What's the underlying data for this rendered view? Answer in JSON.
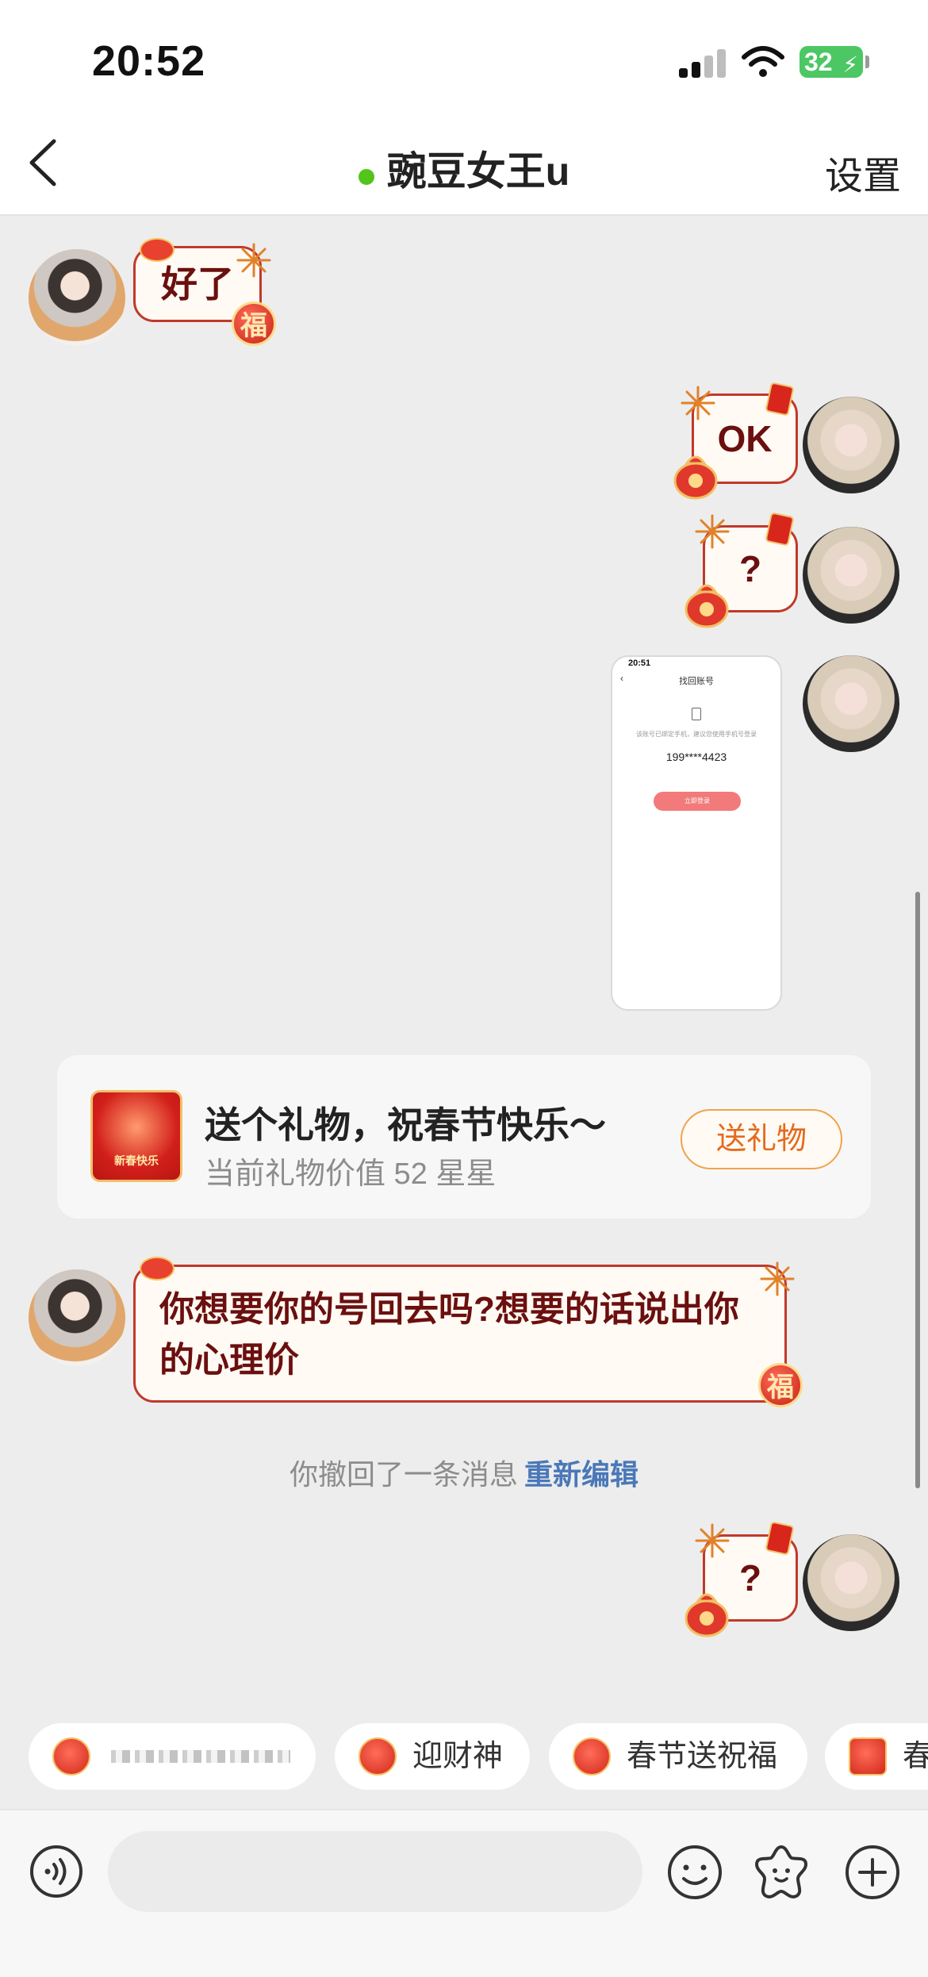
{
  "status_bar": {
    "time": "20:52",
    "battery": "32"
  },
  "header": {
    "title": "豌豆女王u",
    "settings_label": "设置"
  },
  "messages": [
    {
      "sender": "other",
      "type": "text",
      "text": "好了"
    },
    {
      "sender": "me",
      "type": "text",
      "text": "OK"
    },
    {
      "sender": "me",
      "type": "text",
      "text": "?"
    },
    {
      "sender": "me",
      "type": "image",
      "screenshot": {
        "time": "20:51",
        "title": "找回账号",
        "description": "该账号已绑定手机，建议您使用手机号登录",
        "phone_number": "199****4423",
        "button": "立即登录"
      }
    },
    {
      "sender": "other",
      "type": "text",
      "text": "你想要你的号回去吗?想要的话说出你的心理价"
    },
    {
      "sender": "me",
      "type": "text",
      "text": "?"
    }
  ],
  "gift_card": {
    "icon_text": "新春快乐",
    "title": "送个礼物，祝春节快乐～",
    "subtitle": "当前礼物价值 52 星星",
    "button": "送礼物"
  },
  "recall_notice": {
    "text": "你撤回了一条消息",
    "action": "重新编辑"
  },
  "quick_chips": [
    {
      "label": "",
      "icon": "lantern-icon"
    },
    {
      "label": "迎财神",
      "icon": "money-bag-icon"
    },
    {
      "label": "春节送祝福",
      "icon": "fu-icon"
    },
    {
      "label": "春",
      "icon": "red-envelope-icon"
    }
  ],
  "input": {
    "placeholder": ""
  },
  "colors": {
    "bubble_border": "#c0392b",
    "bubble_text": "#6b0f0f",
    "online": "#52c41a",
    "gift_button": "#e46a1e",
    "link": "#4a78b8"
  }
}
